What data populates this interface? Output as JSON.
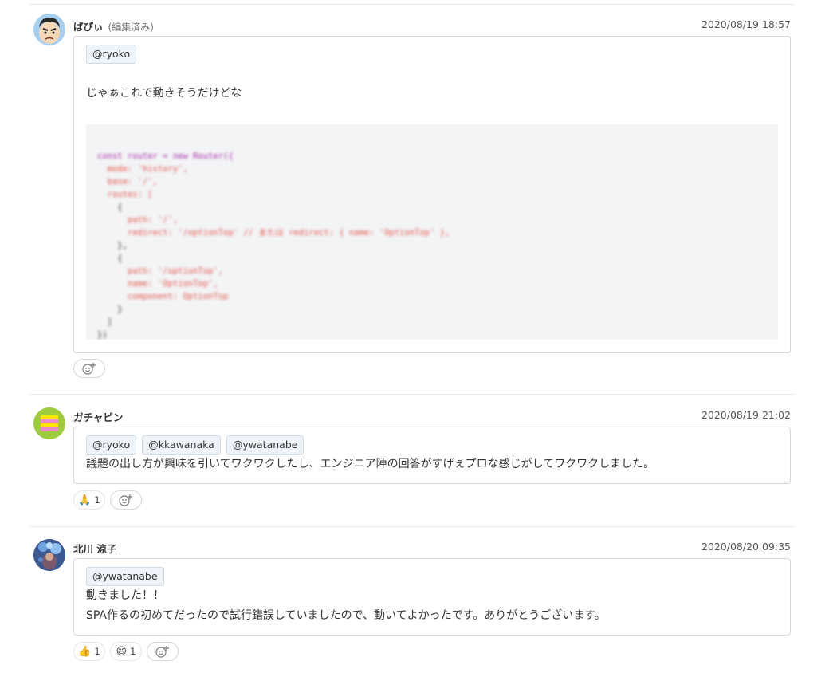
{
  "comments": [
    {
      "author": "ぱぴぃ",
      "edited_label": "(編集済み)",
      "timestamp": "2020/08/19 18:57",
      "mentions": [
        "@ryoko"
      ],
      "lines": [
        "じゃぁこれで動きそうだけどな"
      ],
      "code_lines": [
        "const router = new Router({",
        "  mode: 'history',",
        "  base: '/',",
        "  routes: [",
        "    {",
        "      path: '/',",
        "      redirect: '/optionTop' // または redirect: { name: 'OptionTop' },",
        "    },",
        "    {",
        "      path: '/optionTop',",
        "      name: 'OptionTop',",
        "      component: OptionTop",
        "    }",
        "  ]",
        "})"
      ],
      "reactions": []
    },
    {
      "author": "ガチャピン",
      "timestamp": "2020/08/19 21:02",
      "mentions": [
        "@ryoko",
        "@kkawanaka",
        "@ywatanabe"
      ],
      "lines": [
        "議題の出し方が興味を引いてワクワクしたし、エンジニア陣の回答がすげぇプロな感じがしてワクワクしました。"
      ],
      "reactions": [
        {
          "emoji": "🙏",
          "count": "1"
        }
      ]
    },
    {
      "author": "北川 涼子",
      "timestamp": "2020/08/20 09:35",
      "mentions": [
        "@ywatanabe"
      ],
      "lines": [
        "動きました！！",
        "SPA作るの初めてだったので試行錯誤していましたので、動いてよかったです。ありがとうございます。"
      ],
      "reactions": [
        {
          "emoji": "👍",
          "count": "1"
        },
        {
          "emoji": "😄",
          "count": "1"
        }
      ]
    }
  ],
  "icons": {
    "add_reaction": "smiley-plus-icon"
  }
}
